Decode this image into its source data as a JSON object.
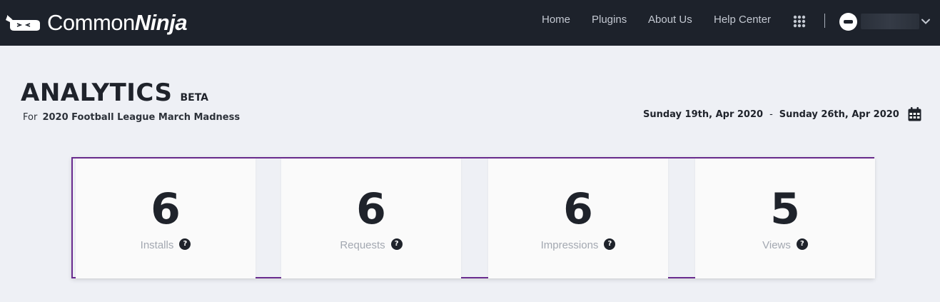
{
  "header": {
    "logo": {
      "text_regular": "Common",
      "text_bold": "Ninja"
    },
    "nav": [
      {
        "label": "Home"
      },
      {
        "label": "Plugins"
      },
      {
        "label": "About Us"
      },
      {
        "label": "Help Center"
      }
    ],
    "icons": [
      "apps-grid-icon",
      "user-avatar-icon",
      "chevron-down-icon"
    ]
  },
  "page": {
    "title": "ANALYTICS",
    "badge": "BETA",
    "subtitle_prefix": "For",
    "subtitle_name": "2020 Football League March Madness",
    "date_start": "Sunday 19th, Apr 2020",
    "date_separator": "-",
    "date_end": "Sunday 26th, Apr 2020"
  },
  "stats": [
    {
      "value": "6",
      "label": "Installs"
    },
    {
      "value": "6",
      "label": "Requests"
    },
    {
      "value": "6",
      "label": "Impressions"
    },
    {
      "value": "5",
      "label": "Views"
    }
  ],
  "help_glyph": "?",
  "colors": {
    "topbar": "#1d222b",
    "highlight_border": "#6a2c8e",
    "page_bg": "#eef0f5",
    "card_bg": "#fafafa"
  }
}
